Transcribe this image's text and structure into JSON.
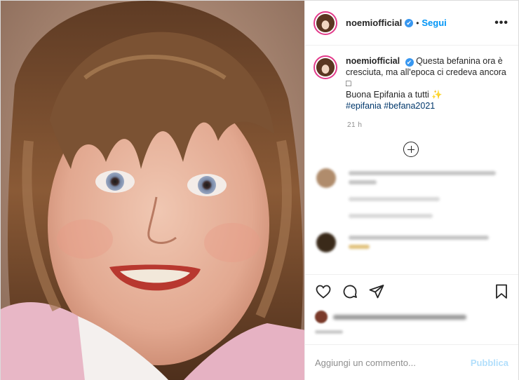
{
  "header": {
    "username": "noemiofficial",
    "verified_glyph": "✔",
    "separator": "•",
    "follow_label": "Segui",
    "more_label": "•••"
  },
  "caption": {
    "username": "noemiofficial",
    "verified_glyph": "✔",
    "line1": "Questa befanina ora è cresciuta, ma all'epoca ci credeva ancora",
    "emoji1": "□",
    "line2": "Buona Epifania a tutti",
    "emoji2": "✨",
    "hashtag1": "#epifania",
    "hashtag2": "#befana2021",
    "time": "21 h"
  },
  "icons": {
    "load_more": "plus-circle-icon",
    "like": "heart-icon",
    "comment": "comment-icon",
    "share": "send-icon",
    "save": "bookmark-icon"
  },
  "comment_box": {
    "placeholder": "Aggiungi un commento...",
    "publish_label": "Pubblica"
  },
  "colors": {
    "accent": "#0095f6",
    "publish_disabled": "#b2dffc",
    "verified": "#3897f0",
    "story_ring": "#e23a8a"
  }
}
